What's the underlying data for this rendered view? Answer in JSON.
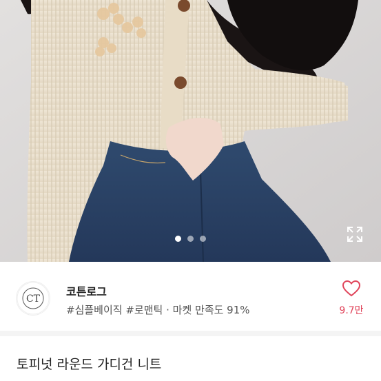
{
  "carousel": {
    "total_images": 3,
    "current_index": 0,
    "expand_icon": "expand-icon"
  },
  "shop": {
    "logo_text": "CT",
    "name": "코튼로그",
    "tags": [
      "#심플베이직",
      "#로맨틱",
      "· 마켓 만족도 91%"
    ],
    "likes": "9.7만",
    "heart_icon": "heart-outline-icon",
    "accent_color": "#e0445a"
  },
  "product": {
    "title": "토피넛 라운드 가디건 니트"
  }
}
